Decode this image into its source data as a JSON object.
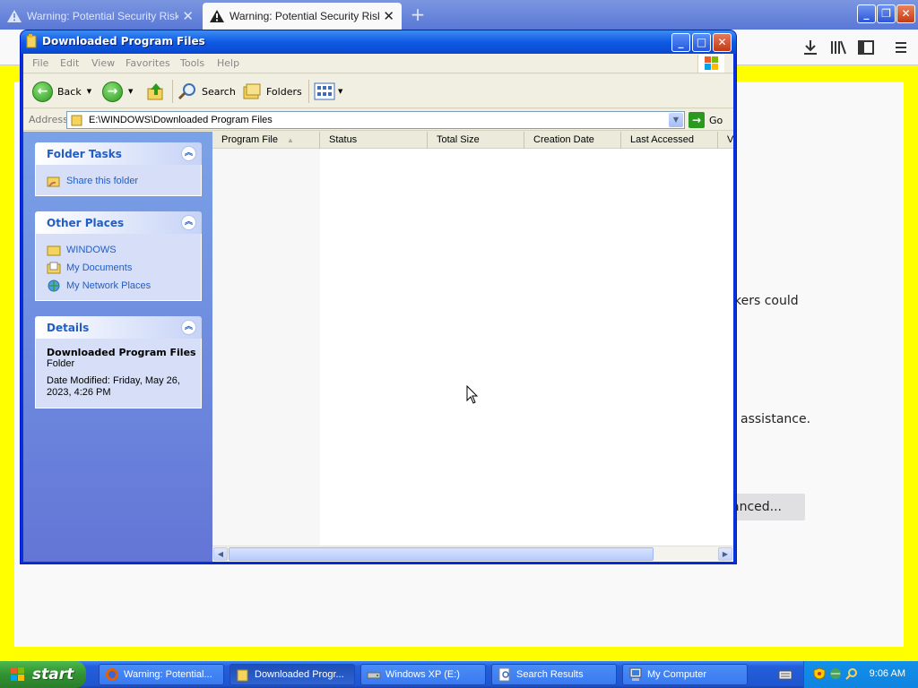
{
  "firefox": {
    "tabs": [
      {
        "title": "Warning: Potential Security Risk Ahead",
        "active": false
      },
      {
        "title": "Warning: Potential Security Risk Ahead",
        "active": true
      }
    ],
    "new_tab": "+",
    "page_fragments": {
      "line1": "kers could",
      "line2": "assistance.",
      "advanced_button": "anced..."
    },
    "accent_color": "#ffff00"
  },
  "explorer": {
    "title": "Downloaded Program Files",
    "window_buttons": {
      "minimize": "_",
      "maximize": "□",
      "close": "✕"
    },
    "menu": [
      "File",
      "Edit",
      "View",
      "Favorites",
      "Tools",
      "Help"
    ],
    "toolbar": {
      "back": "Back",
      "search": "Search",
      "folders": "Folders"
    },
    "address": {
      "label": "Address",
      "value": "E:\\WINDOWS\\Downloaded Program Files",
      "go": "Go"
    },
    "folder_tasks": {
      "heading": "Folder Tasks",
      "items": [
        {
          "label": "Share this folder",
          "icon": "share-folder-icon"
        }
      ]
    },
    "other_places": {
      "heading": "Other Places",
      "items": [
        {
          "label": "WINDOWS",
          "icon": "folder-icon"
        },
        {
          "label": "My Documents",
          "icon": "my-documents-icon"
        },
        {
          "label": "My Network Places",
          "icon": "network-places-icon"
        }
      ]
    },
    "details": {
      "heading": "Details",
      "name": "Downloaded Program Files",
      "type": "Folder",
      "modified": "Date Modified: Friday, May 26, 2023, 4:26 PM"
    },
    "columns": [
      "Program File",
      "Status",
      "Total Size",
      "Creation Date",
      "Last Accessed",
      "Ve"
    ]
  },
  "taskbar": {
    "start": "start",
    "buttons": [
      {
        "label": "Warning: Potential...",
        "icon": "firefox-icon"
      },
      {
        "label": "Downloaded Progr...",
        "icon": "folder-icon",
        "active": true
      },
      {
        "label": "Windows XP (E:)",
        "icon": "drive-icon"
      },
      {
        "label": "Search Results",
        "icon": "search-results-icon"
      },
      {
        "label": "My Computer",
        "icon": "my-computer-icon"
      }
    ],
    "clock": "9:06 AM"
  }
}
